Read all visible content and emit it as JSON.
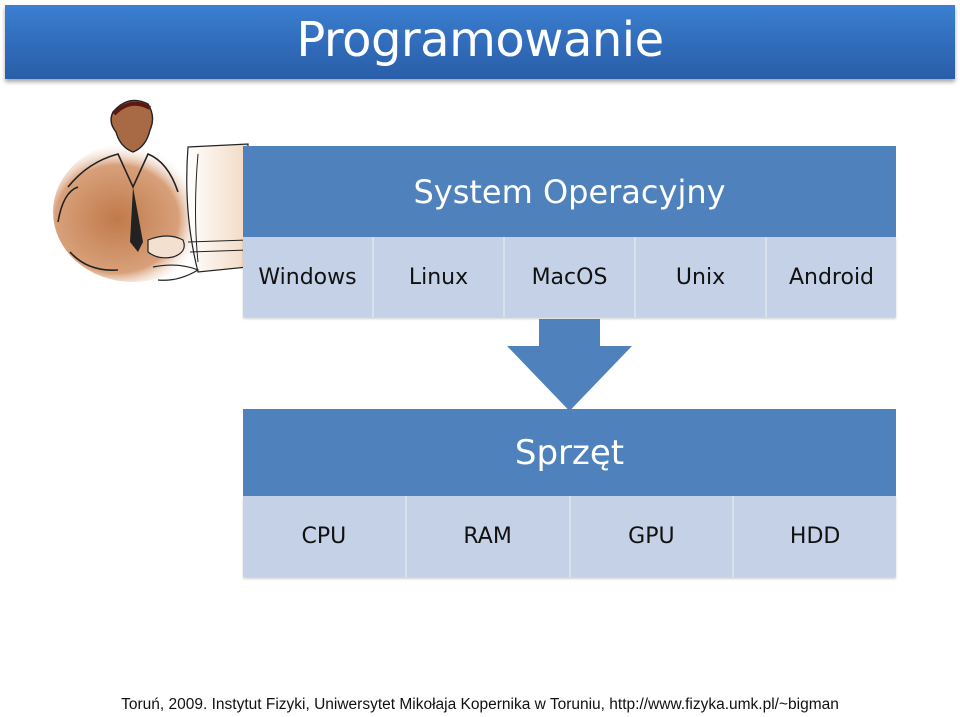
{
  "slide": {
    "title": "Programowanie",
    "clipart": "man-at-computer-illustration",
    "os_block": {
      "header": "System Operacyjny",
      "items": [
        "Windows",
        "Linux",
        "MacOS",
        "Unix",
        "Android"
      ]
    },
    "connector": "down-arrow",
    "hardware_block": {
      "header": "Sprzęt",
      "items": [
        "CPU",
        "RAM",
        "GPU",
        "HDD"
      ]
    },
    "footer": "Toruń, 2009. Instytut Fizyki, Uniwersytet Mikołaja Kopernika w Toruniu, http://www.fizyka.umk.pl/~bigman"
  },
  "colors": {
    "title_bar": "#3572c0",
    "header_fill": "#4f81bd",
    "row_fill": "#c5d1e7",
    "text_light": "#ffffff",
    "text_dark": "#111111"
  }
}
